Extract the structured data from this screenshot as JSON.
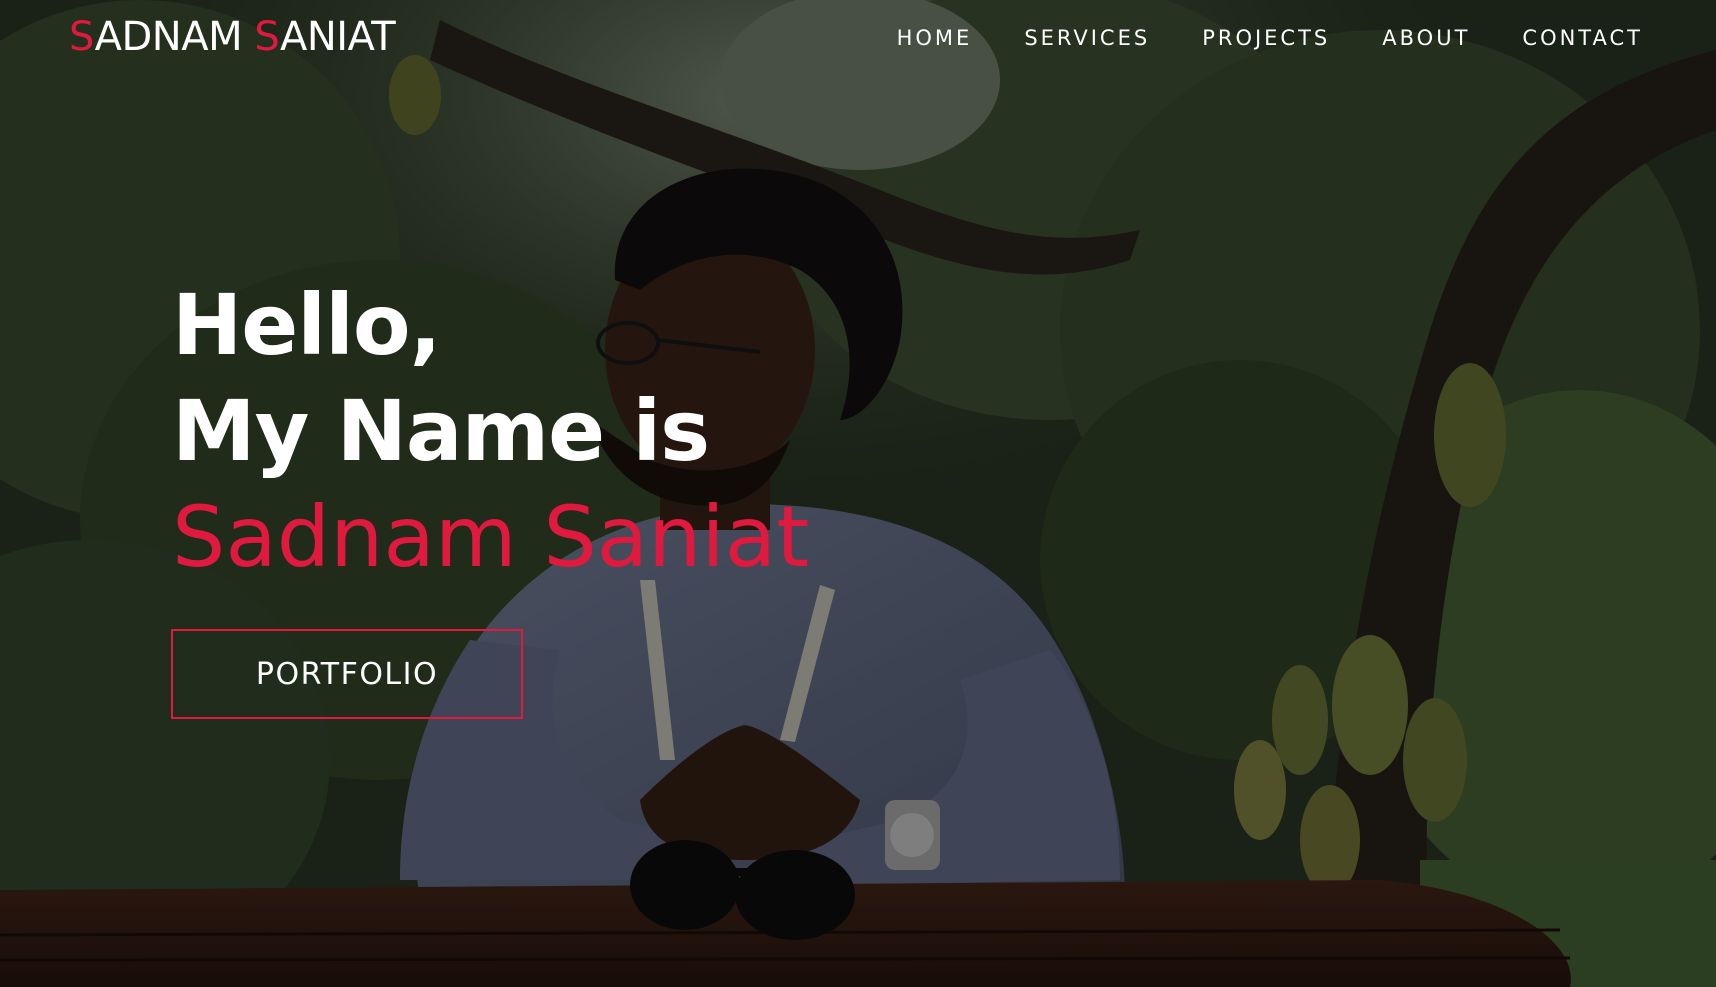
{
  "brand": {
    "first_initial": "S",
    "first_rest": "ADNAM ",
    "second_initial": "S",
    "second_rest": "ANIAT"
  },
  "nav": {
    "items": [
      {
        "label": "HOME"
      },
      {
        "label": "SERVICES"
      },
      {
        "label": "PROJECTS"
      },
      {
        "label": "ABOUT"
      },
      {
        "label": "CONTACT"
      }
    ]
  },
  "hero": {
    "line1": "Hello,",
    "line2": "My Name is",
    "name": "Sadnam Saniat",
    "cta_label": "PORTFOLIO"
  },
  "colors": {
    "accent": "#e0193f",
    "text": "#ffffff"
  }
}
